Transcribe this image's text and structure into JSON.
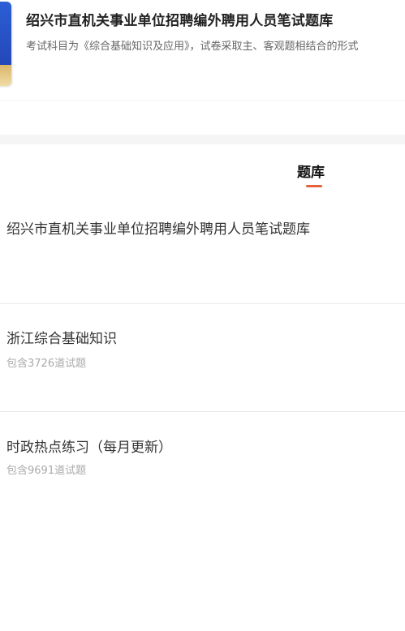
{
  "header": {
    "title": "绍兴市直机关事业单位招聘编外聘用人员笔试题库",
    "description": "考试科目为《综合基础知识及应用》，试卷采取主、客观题相结合的形式"
  },
  "tabs": [
    {
      "label": "题库",
      "active": true
    }
  ],
  "list": {
    "items": [
      {
        "title": "绍兴市直机关事业单位招聘编外聘用人员笔试题库",
        "subtitle": ""
      },
      {
        "title": "浙江综合基础知识",
        "subtitle": "包含3726道试题"
      },
      {
        "title": "时政热点练习（每月更新）",
        "subtitle": "包含9691道试题"
      }
    ]
  },
  "colors": {
    "accent": "#e4623b",
    "cover_blue": "#2b5fd6",
    "cover_gold": "#d9b56a"
  }
}
